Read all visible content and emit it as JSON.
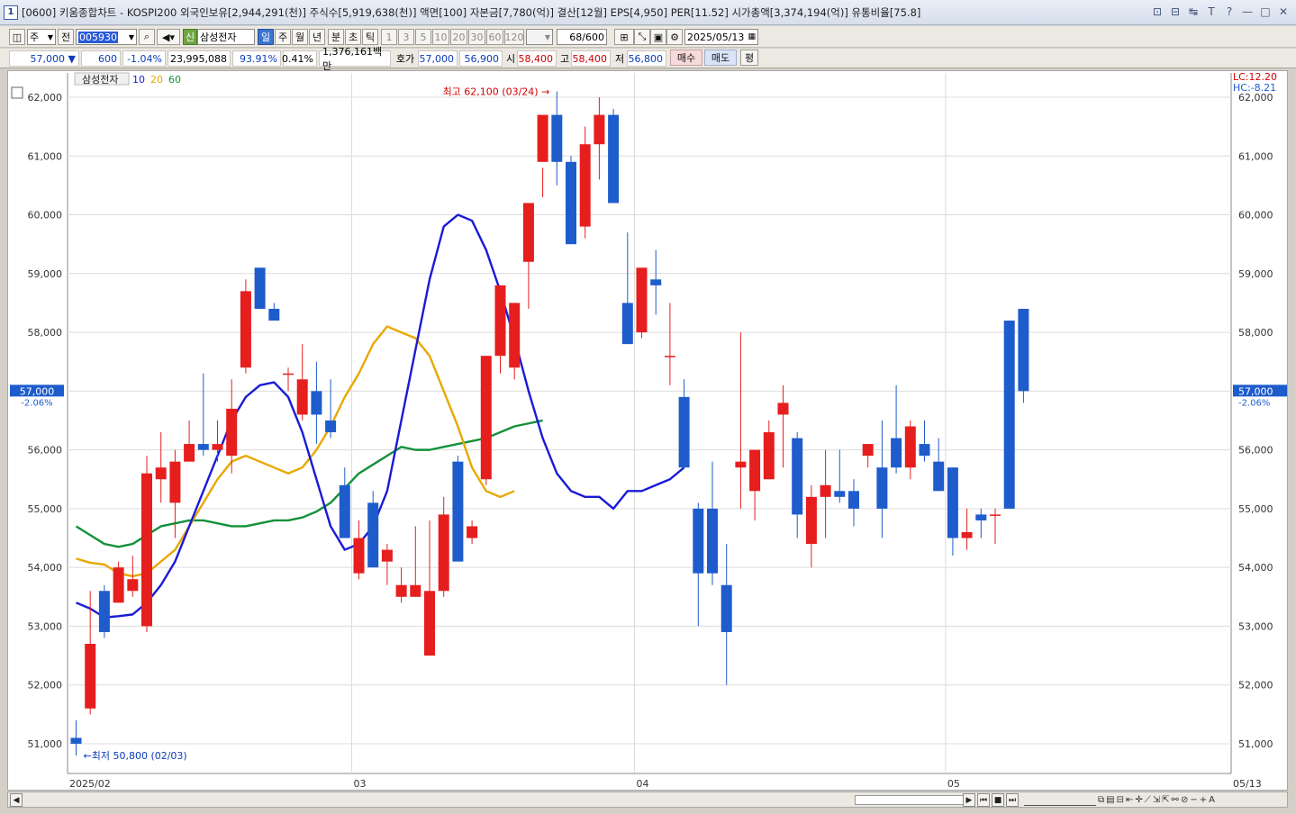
{
  "window": {
    "app_number": "1",
    "title": "[0600] 키움종합차트 - KOSPI200 외국인보유[2,944,291(천)] 주식수[5,919,638(천)] 액면[100] 자본금[7,780(억)] 결산[12월] EPS[4,950] PER[11.52] 시가총액[3,374,194(억)] 유통비율[75.8]",
    "controls": [
      "⊡",
      "⊟",
      "↹",
      "T",
      "?",
      "—",
      "□",
      "✕"
    ]
  },
  "toolbar": {
    "period_type": "주",
    "all": "전",
    "code": "005930",
    "stock_name": "삼성전자",
    "new_badge": "신",
    "intervals": [
      "일",
      "주",
      "월",
      "년",
      "분",
      "초",
      "틱"
    ],
    "selected_interval": "일",
    "minute_presets": [
      "1",
      "3",
      "5",
      "10",
      "20",
      "30",
      "60",
      "120"
    ],
    "count": "68",
    "count_max": "/600",
    "date": "2025/05/13"
  },
  "quote": {
    "price": "57,000",
    "direction": "▼",
    "change": "600",
    "change_pct": "-1.04%",
    "volume": "23,995,088",
    "vol_ratio": "93.91%",
    "turnover_pct": "0.41%",
    "amount": "1,376,161백만",
    "label_hoga": "호가",
    "ask": "57,000",
    "bid": "56,900",
    "label_open": "시",
    "open": "58,400",
    "label_high": "고",
    "high": "58,400",
    "label_low": "저",
    "low": "56,800",
    "buy": "매수",
    "sell": "매도",
    "avg": "평"
  },
  "chart_data": {
    "type": "candlestick",
    "legend": {
      "name": "삼성전자",
      "ma": [
        {
          "period": "10",
          "color": "#1a1ad8"
        },
        {
          "period": "20",
          "color": "#e8a800"
        },
        {
          "period": "60",
          "color": "#13913a"
        }
      ]
    },
    "y_ticks": [
      "62,000",
      "61,000",
      "60,000",
      "59,000",
      "58,000",
      "57,000",
      "56,000",
      "55,000",
      "54,000",
      "53,000",
      "52,000",
      "51,000"
    ],
    "ylim": [
      50500,
      62450
    ],
    "x_labels": [
      {
        "text": "2025/02",
        "index": 0
      },
      {
        "text": "03",
        "index": 20
      },
      {
        "text": "04",
        "index": 40
      },
      {
        "text": "05",
        "index": 62
      },
      {
        "text": "05/13",
        "index": 69
      }
    ],
    "high_annotation": "최고 62,100 (03/24)",
    "low_annotation": "←최저 50,800 (02/03)",
    "current_price_tag": "57,000",
    "current_pct": "-2.06%",
    "lc": "LC:12.20",
    "hc": "HC:-8.21",
    "up_color": "#e61e1e",
    "down_color": "#1e5ccc",
    "candles": [
      [
        51100,
        51400,
        50800,
        51000
      ],
      [
        51600,
        53600,
        51500,
        52700
      ],
      [
        53600,
        53700,
        52800,
        52900
      ],
      [
        53400,
        54100,
        53400,
        54000
      ],
      [
        53600,
        54200,
        53500,
        53800
      ],
      [
        53000,
        55900,
        52900,
        55600
      ],
      [
        55500,
        56300,
        55100,
        55700
      ],
      [
        55100,
        56000,
        54500,
        55800
      ],
      [
        55800,
        56500,
        55800,
        56100
      ],
      [
        56100,
        57300,
        55900,
        56000
      ],
      [
        56000,
        56500,
        55800,
        56100
      ],
      [
        55900,
        57200,
        55600,
        56700
      ],
      [
        57400,
        58900,
        57300,
        58700
      ],
      [
        59100,
        59100,
        58400,
        58400
      ],
      [
        58400,
        58500,
        58200,
        58200
      ],
      [
        57300,
        57400,
        57000,
        57300
      ],
      [
        56600,
        57800,
        56500,
        57200
      ],
      [
        57000,
        57500,
        56100,
        56600
      ],
      [
        56500,
        57200,
        56200,
        56300
      ],
      [
        55400,
        55700,
        54500,
        54500
      ],
      [
        53900,
        54800,
        53800,
        54500
      ],
      [
        55100,
        55300,
        54500,
        54000
      ],
      [
        54100,
        54400,
        53700,
        54300
      ],
      [
        53500,
        54000,
        53400,
        53700
      ],
      [
        53500,
        54700,
        53500,
        53700
      ],
      [
        52500,
        54800,
        52500,
        53600
      ],
      [
        53600,
        55200,
        53500,
        54900
      ],
      [
        55800,
        55900,
        54200,
        54100
      ],
      [
        54500,
        54800,
        54400,
        54700
      ],
      [
        55500,
        57600,
        55400,
        57600
      ],
      [
        57600,
        58700,
        57300,
        58800
      ],
      [
        57400,
        58500,
        57200,
        58500
      ],
      [
        59200,
        59700,
        58400,
        60200
      ],
      [
        60900,
        60300,
        60800,
        61700
      ],
      [
        61700,
        62100,
        60500,
        60900
      ],
      [
        60900,
        61000,
        59500,
        59500
      ],
      [
        59800,
        61500,
        59600,
        61200
      ],
      [
        61200,
        62000,
        60600,
        61700
      ],
      [
        61700,
        61800,
        60200,
        60200
      ],
      [
        58500,
        59700,
        58000,
        57800
      ],
      [
        58000,
        59000,
        57900,
        59100
      ],
      [
        58900,
        59400,
        58300,
        58800
      ],
      [
        57600,
        58500,
        57100,
        57600
      ],
      [
        56900,
        57200,
        55700,
        55700
      ],
      [
        55000,
        55100,
        53000,
        53900
      ],
      [
        55000,
        55800,
        53700,
        53900
      ],
      [
        53700,
        54400,
        52000,
        52900
      ],
      [
        55700,
        58000,
        55000,
        55800
      ],
      [
        55300,
        56000,
        54800,
        56000
      ],
      [
        55500,
        56500,
        55500,
        56300
      ],
      [
        56600,
        57100,
        55700,
        56800
      ],
      [
        56200,
        56300,
        54500,
        54900
      ],
      [
        54400,
        55400,
        54000,
        55200
      ],
      [
        55200,
        56000,
        54500,
        55400
      ],
      [
        55300,
        56000,
        55100,
        55200
      ],
      [
        55300,
        55500,
        54700,
        55000
      ],
      [
        55900,
        56100,
        55700,
        56100
      ],
      [
        55700,
        56500,
        54500,
        55000
      ],
      [
        56200,
        57100,
        55600,
        55700
      ],
      [
        55700,
        56500,
        55500,
        56400
      ],
      [
        56100,
        56500,
        55800,
        55900
      ],
      [
        55800,
        56200,
        55500,
        55300
      ],
      [
        55700,
        55700,
        54200,
        54500
      ],
      [
        54500,
        55000,
        54300,
        54600
      ],
      [
        54900,
        55000,
        54500,
        54800
      ],
      [
        54900,
        55000,
        54400,
        54900
      ],
      [
        58200,
        58200,
        55000,
        55000
      ],
      [
        58400,
        58400,
        56800,
        57000
      ]
    ],
    "ma10": [
      53400,
      53300,
      53150,
      53170,
      53200,
      53400,
      53700,
      54100,
      54700,
      55300,
      55900,
      56500,
      56900,
      57100,
      57150,
      56900,
      56300,
      55500,
      54700,
      54300,
      54400,
      54700,
      55300,
      56500,
      57700,
      58900,
      59800,
      60000,
      59900,
      59400,
      58700,
      57900,
      57000,
      56200,
      55600,
      55300,
      55200,
      55200,
      55000,
      55300,
      55300,
      55400,
      55500,
      55700
    ],
    "ma20": [
      54150,
      54080,
      54050,
      53900,
      53850,
      53900,
      54100,
      54300,
      54700,
      55100,
      55500,
      55800,
      55900,
      55800,
      55700,
      55600,
      55700,
      56000,
      56400,
      56900,
      57300,
      57800,
      58100,
      58000,
      57900,
      57600,
      57000,
      56400,
      55700,
      55300,
      55200,
      55300
    ],
    "ma60": [
      54700,
      54550,
      54400,
      54350,
      54400,
      54550,
      54700,
      54750,
      54800,
      54800,
      54750,
      54700,
      54700,
      54750,
      54800,
      54800,
      54850,
      54950,
      55100,
      55350,
      55600,
      55750,
      55900,
      56050,
      56000,
      56000,
      56050,
      56100,
      56150,
      56200,
      56300,
      56400,
      56450,
      56500
    ]
  },
  "scrollbar": {
    "left": "◀",
    "right": "▶"
  }
}
